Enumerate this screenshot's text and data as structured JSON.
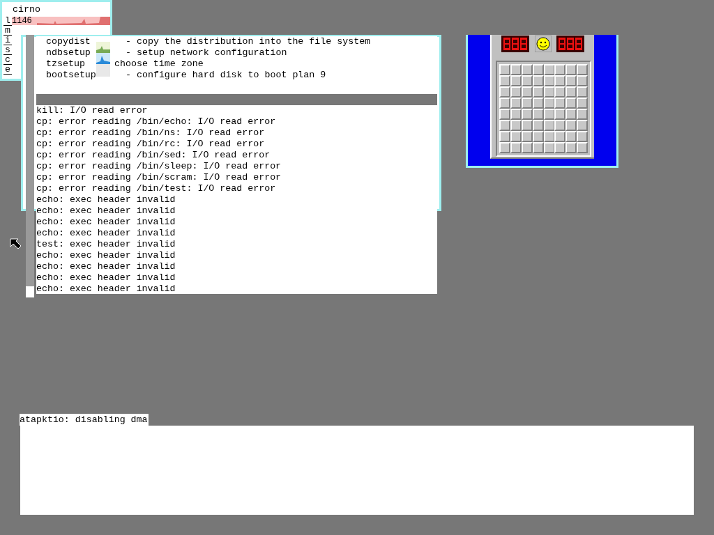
{
  "stats": {
    "host": "cirno",
    "rows": [
      {
        "letter": "l",
        "value": "1146"
      },
      {
        "letter": "m"
      },
      {
        "letter": "i"
      },
      {
        "letter": "s"
      },
      {
        "letter": "c"
      },
      {
        "letter": "e"
      }
    ]
  },
  "help_lines": [
    {
      "command": "copydist",
      "description": "- copy the distribution into the file system"
    },
    {
      "command": "ndbsetup",
      "description": "- setup network configuration"
    },
    {
      "command": "tzsetup",
      "description": "choose time zone"
    },
    {
      "command": "bootsetup",
      "description": "- configure hard disk to boot plan 9"
    }
  ],
  "log_lines": [
    "kill: I/O read error",
    "cp: error reading /bin/echo: I/O read error",
    "cp: error reading /bin/ns: I/O read error",
    "cp: error reading /bin/rc: I/O read error",
    "cp: error reading /bin/sed: I/O read error",
    "cp: error reading /bin/sleep: I/O read error",
    "cp: error reading /bin/scram: I/O read error",
    "cp: error reading /bin/test: I/O read error",
    "echo: exec header invalid",
    "echo: exec header invalid",
    "echo: exec header invalid",
    "echo: exec header invalid",
    "test: exec header invalid",
    "echo: exec header invalid",
    "echo: exec header invalid",
    "echo: exec header invalid",
    "echo: exec header invalid"
  ],
  "console": {
    "message": "atapktio: disabling dma"
  }
}
